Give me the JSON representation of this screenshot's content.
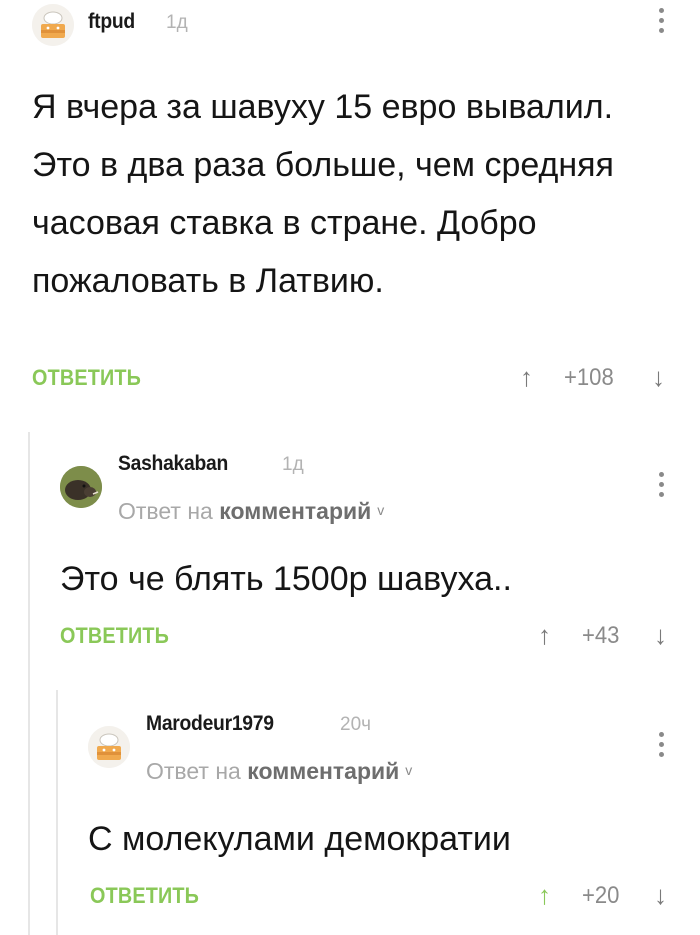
{
  "comments": [
    {
      "author": "ftpud",
      "time": "1д",
      "text": "Я вчера за шавуху 15 евро вывалил. Это в два раза больше, чем средняя часовая ставка в стране. Добро пожаловать в Латвию.",
      "reply_label": "ОТВЕТИТЬ",
      "score": "+108",
      "avatar": "cake-avatar-icon"
    },
    {
      "author": "Sashakaban",
      "time": "1д",
      "reply_to_prefix": "Ответ на",
      "reply_to_target": "комментарий",
      "text": "Это че блять 1500р шавуха..",
      "reply_label": "ОТВЕТИТЬ",
      "score": "+43",
      "avatar": "boar-avatar-icon"
    },
    {
      "author": "Marodeur1979",
      "time": "20ч",
      "reply_to_prefix": "Ответ на",
      "reply_to_target": "комментарий",
      "text": "С молекулами демократии",
      "reply_label": "ОТВЕТИТЬ",
      "score": "+20",
      "avatar": "cake-avatar-icon"
    }
  ],
  "icons": {
    "upvote": "↑",
    "downvote": "↓",
    "chevron": "v"
  },
  "colors": {
    "accent_green": "#8ac858",
    "muted_gray": "#a8a8a8"
  }
}
